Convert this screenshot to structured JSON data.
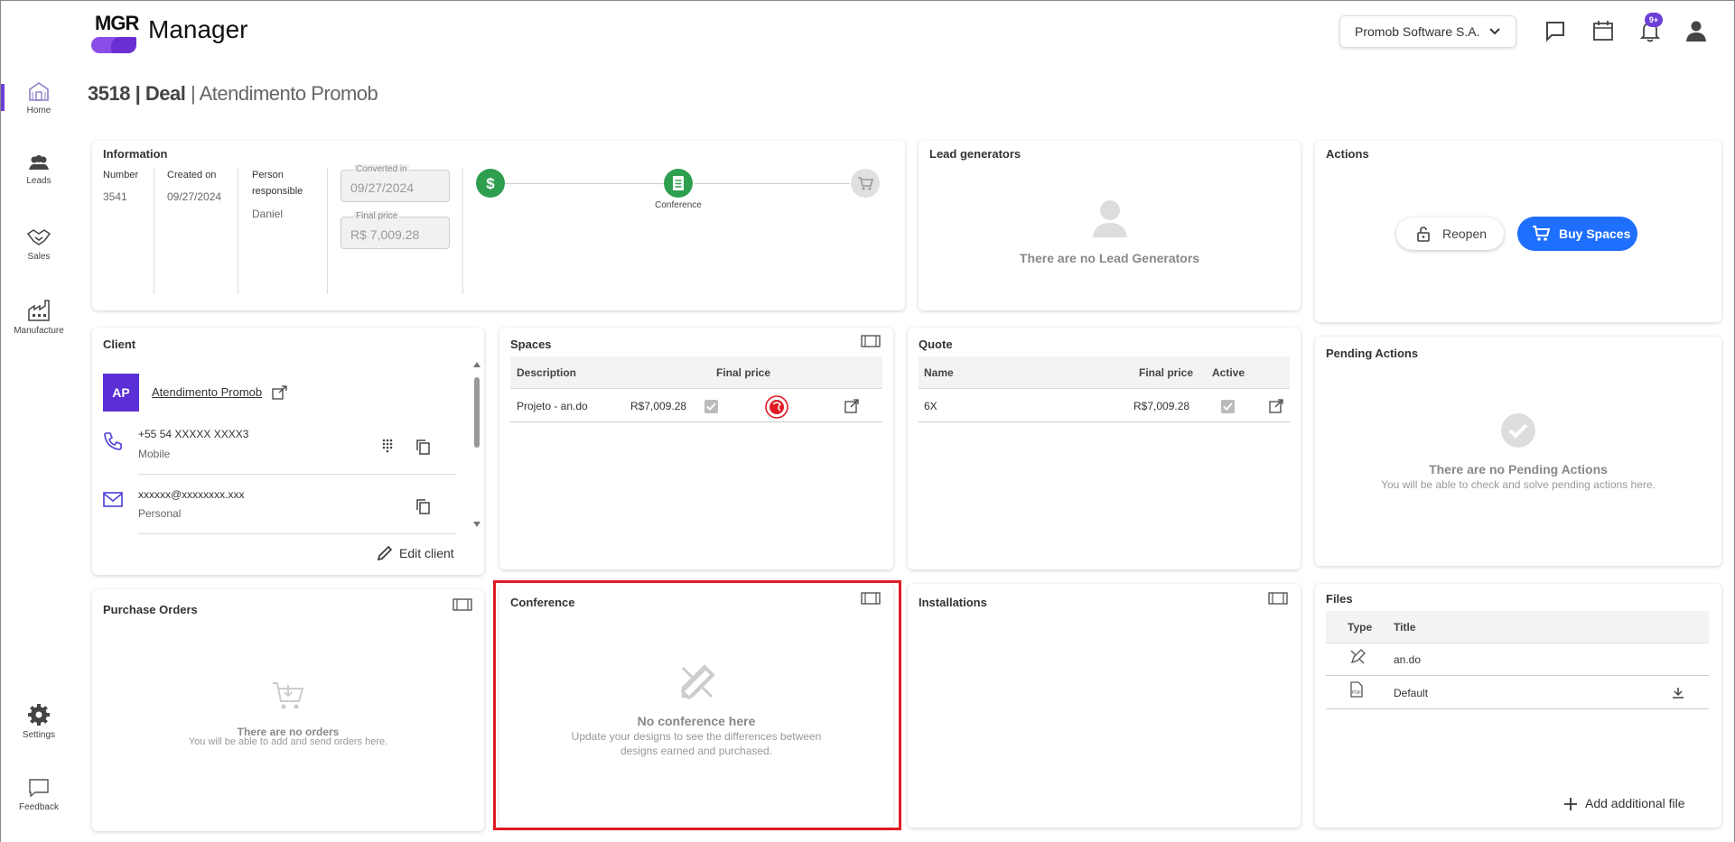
{
  "header": {
    "logo_text": "MGR",
    "app_name": "Manager",
    "company": "Promob Software S.A.",
    "notif_badge": "9+"
  },
  "sidebar": {
    "items": [
      {
        "label": "Home",
        "icon": "home-icon"
      },
      {
        "label": "Leads",
        "icon": "people-icon"
      },
      {
        "label": "Sales",
        "icon": "handshake-icon"
      },
      {
        "label": "Manufacture",
        "icon": "factory-icon"
      }
    ],
    "bottom": [
      {
        "label": "Settings",
        "icon": "gear-icon"
      },
      {
        "label": "Feedback",
        "icon": "feedback-icon"
      }
    ]
  },
  "title": {
    "id": "3518",
    "sep1": "|",
    "type": "Deal",
    "sep2": "|",
    "name": "Atendimento Promob"
  },
  "information": {
    "title": "Information",
    "number_label": "Number",
    "number": "3541",
    "created_label": "Created on",
    "created": "09/27/2024",
    "responsible_label_1": "Person",
    "responsible_label_2": "responsible",
    "responsible": "Daniel",
    "converted_label": "Converted in",
    "converted": "09/27/2024",
    "final_price_label": "Final price",
    "final_price": "R$ 7,009.28",
    "stepper_label": "Conference"
  },
  "lead_generators": {
    "title": "Lead generators",
    "empty": "There are no Lead Generators"
  },
  "actions": {
    "title": "Actions",
    "reopen": "Reopen",
    "buy": "Buy Spaces"
  },
  "client": {
    "title": "Client",
    "initials": "AP",
    "name": "Atendimento Promob",
    "phone": "+55 54 XXXXX XXXX3",
    "phone_type": "Mobile",
    "email": "xxxxxx@xxxxxxxx.xxx",
    "email_type": "Personal",
    "edit": "Edit client"
  },
  "spaces": {
    "title": "Spaces",
    "headers": [
      "Description",
      "Final price"
    ],
    "rows": [
      {
        "description": "Projeto - an.do",
        "price": "R$7,009.28"
      }
    ]
  },
  "quote": {
    "title": "Quote",
    "headers": [
      "Name",
      "Final price",
      "Active"
    ],
    "rows": [
      {
        "name": "6X",
        "price": "R$7,009.28"
      }
    ]
  },
  "pending": {
    "title": "Pending Actions",
    "empty": "There are no Pending Actions",
    "sub": "You will be able to check and solve pending actions here."
  },
  "purchase_orders": {
    "title": "Purchase Orders",
    "empty": "There are no orders",
    "sub": "You will be able to add and send orders here."
  },
  "conference": {
    "title": "Conference",
    "empty": "No conference here",
    "sub1": "Update your designs to see the differences between",
    "sub2": "designs earned and purchased."
  },
  "installations": {
    "title": "Installations"
  },
  "files": {
    "title": "Files",
    "headers": [
      "Type",
      "Title"
    ],
    "rows": [
      {
        "title": "an.do",
        "type_icon": "design-file-icon"
      },
      {
        "title": "Default",
        "type_icon": "pdf-file-icon"
      }
    ],
    "add": "Add additional file"
  }
}
